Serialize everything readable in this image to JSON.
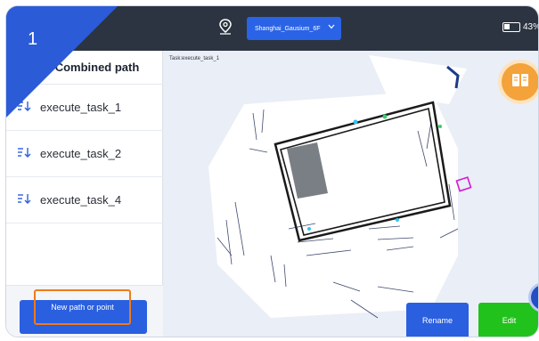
{
  "corner_badge": {
    "number": "1"
  },
  "topbar": {
    "map_name": "Shanghai_Gausium_6F",
    "battery_percent": "43%",
    "battery_level": 0.43
  },
  "sidebar": {
    "title": "Combined path",
    "items": [
      {
        "label": "execute_task_1"
      },
      {
        "label": "execute_task_2"
      },
      {
        "label": "execute_task_4"
      }
    ],
    "new_button_label": "New path or point"
  },
  "map": {
    "task_title": "Task:execute_task_1"
  },
  "actions": {
    "rename_label": "Rename",
    "edit_label": "Edit"
  },
  "colors": {
    "accent_blue": "#2a5fe0",
    "edit_green": "#21c21b",
    "highlight_orange": "#f07a1a",
    "topbar_dark": "#2b3440"
  },
  "icons": {
    "location": "map-pin-icon",
    "sort": "sort-down-icon",
    "manual": "book-icon"
  }
}
